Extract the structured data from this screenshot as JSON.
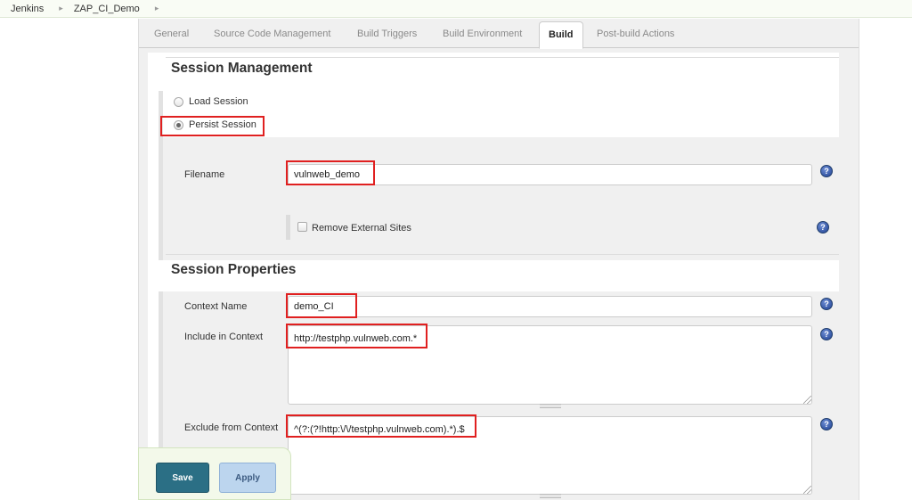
{
  "breadcrumb": {
    "items": [
      "Jenkins",
      "ZAP_CI_Demo"
    ]
  },
  "tabs": [
    {
      "label": "General"
    },
    {
      "label": "Source Code Management"
    },
    {
      "label": "Build Triggers"
    },
    {
      "label": "Build Environment"
    },
    {
      "label": "Build",
      "active": true
    },
    {
      "label": "Post-build Actions"
    }
  ],
  "session_management": {
    "title": "Session Management",
    "load_label": "Load Session",
    "persist_label": "Persist Session",
    "selected": "Persist Session",
    "filename_label": "Filename",
    "filename_value": "vulnweb_demo",
    "remove_external_label": "Remove External Sites",
    "remove_external_checked": false
  },
  "session_properties": {
    "title": "Session Properties",
    "context_name_label": "Context Name",
    "context_name_value": "demo_CI",
    "include_label": "Include in Context",
    "include_value": "http://testphp.vulnweb.com.*",
    "exclude_label": "Exclude from Context",
    "exclude_value": "^(?:(?!http:\\/\\/testphp.vulnweb.com).*).$"
  },
  "help_symbol": "?",
  "buttons": {
    "save": "Save",
    "apply": "Apply"
  },
  "colors": {
    "annotation_red": "#e02020",
    "save_bg": "#2b6f85",
    "apply_bg": "#bcd5ee",
    "help_icon": "#2a4fa8"
  }
}
